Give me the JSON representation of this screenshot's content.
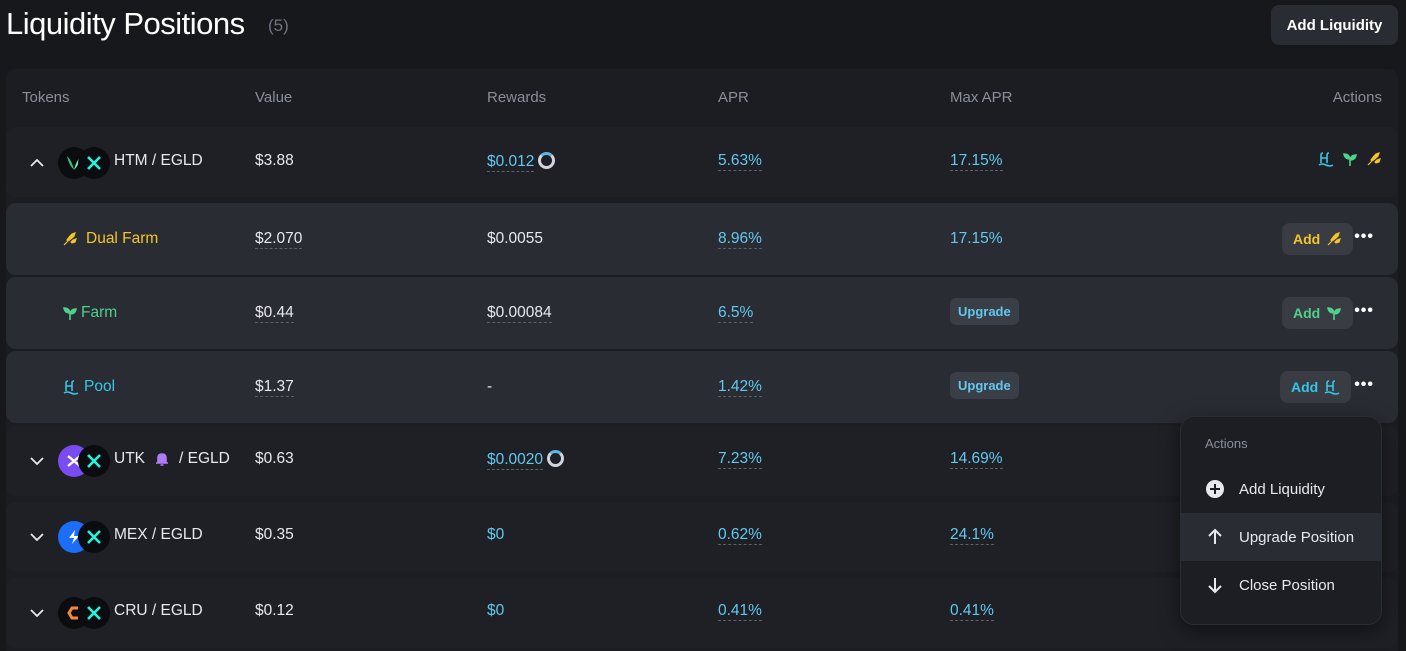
{
  "header": {
    "title": "Liquidity Positions",
    "count": "(5)",
    "add_liquidity_label": "Add Liquidity"
  },
  "columns": {
    "tokens": "Tokens",
    "value": "Value",
    "rewards": "Rewards",
    "apr": "APR",
    "max_apr": "Max APR",
    "actions": "Actions"
  },
  "positions": [
    {
      "pair": "HTM / EGLD",
      "value": "$3.88",
      "rewards": "$0.012",
      "apr": "5.63%",
      "max_apr": "17.15%",
      "expanded": true,
      "sub_rows": [
        {
          "name": "Dual Farm",
          "value": "$2.070",
          "rewards": "$0.0055",
          "apr": "8.96%",
          "max_apr": "17.15%",
          "add_label": "Add"
        },
        {
          "name": "Farm",
          "value": "$0.44",
          "rewards": "$0.00084",
          "apr": "6.5%",
          "max_apr": "Upgrade",
          "add_label": "Add"
        },
        {
          "name": "Pool",
          "value": "$1.37",
          "rewards": "-",
          "apr": "1.42%",
          "max_apr": "Upgrade",
          "add_label": "Add"
        }
      ]
    },
    {
      "pair_left": "UTK",
      "pair_right": "/ EGLD",
      "value": "$0.63",
      "rewards": "$0.0020",
      "apr": "7.23%",
      "max_apr": "14.69%",
      "expanded": false
    },
    {
      "pair": "MEX / EGLD",
      "value": "$0.35",
      "rewards": "$0",
      "apr": "0.62%",
      "max_apr": "24.1%",
      "expanded": false
    },
    {
      "pair": "CRU / EGLD",
      "value": "$0.12",
      "rewards": "$0",
      "apr": "0.41%",
      "max_apr": "0.41%",
      "expanded": false
    }
  ],
  "actions_menu": {
    "heading": "Actions",
    "items": [
      {
        "label": "Add Liquidity",
        "icon": "plus-circle-icon"
      },
      {
        "label": "Upgrade Position",
        "icon": "arrow-up-icon"
      },
      {
        "label": "Close Position",
        "icon": "arrow-down-icon"
      }
    ],
    "highlighted_index": 1
  },
  "colors": {
    "background": "#17181c",
    "accent_blue": "#62c8ef",
    "dual_farm_yellow": "#f5c527",
    "farm_green": "#4fd18b",
    "pool_cyan": "#35c6e8"
  }
}
